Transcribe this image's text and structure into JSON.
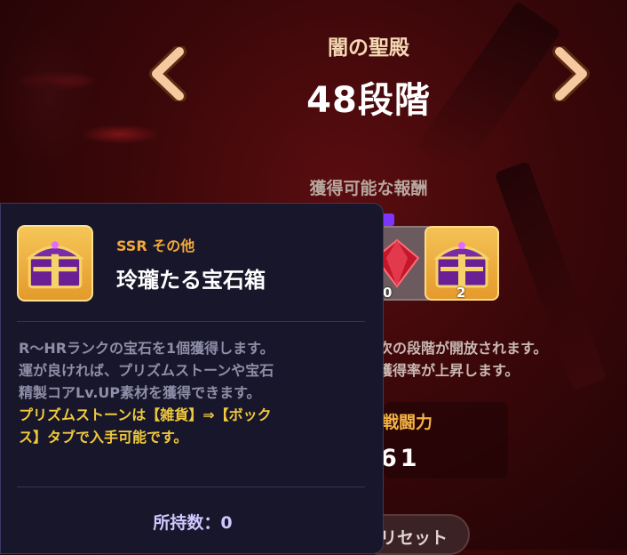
{
  "stage": {
    "title": "闇の聖殿",
    "level": "48段階"
  },
  "rewards": {
    "heading": "獲得可能な報酬",
    "items": [
      {
        "count": "0"
      },
      {
        "count": "2"
      }
    ]
  },
  "info": {
    "line1": "次の段階が開放されます。",
    "line2": "獲得率が上昇します。"
  },
  "power": {
    "label": "戦闘力",
    "value": "61"
  },
  "reset": {
    "label": "リセット"
  },
  "tooltip": {
    "rarity": "SSR",
    "category": "その他",
    "item_name": "玲瓏たる宝石箱",
    "description": [
      "R～HRランクの宝石を1個獲得します。",
      "運が良ければ、プリズムストーンや宝石",
      "精製コアLv.UP素材を獲得できます。"
    ],
    "note": [
      "プリズムストーンは【雑貨】⇒【ボック",
      "ス】タブで入手可能です。"
    ],
    "owned_label": "所持数：",
    "owned_value": "0"
  },
  "colors": {
    "accent_gold": "#f3a93a",
    "note_yellow": "#f1c93b",
    "background_red": "#3a0709",
    "tooltip_bg": "#17162a"
  },
  "icons": {
    "left_arrow": "chevron-left-icon",
    "right_arrow": "chevron-right-icon",
    "chest": "treasure-chest-icon",
    "gem": "red-gem-icon"
  }
}
